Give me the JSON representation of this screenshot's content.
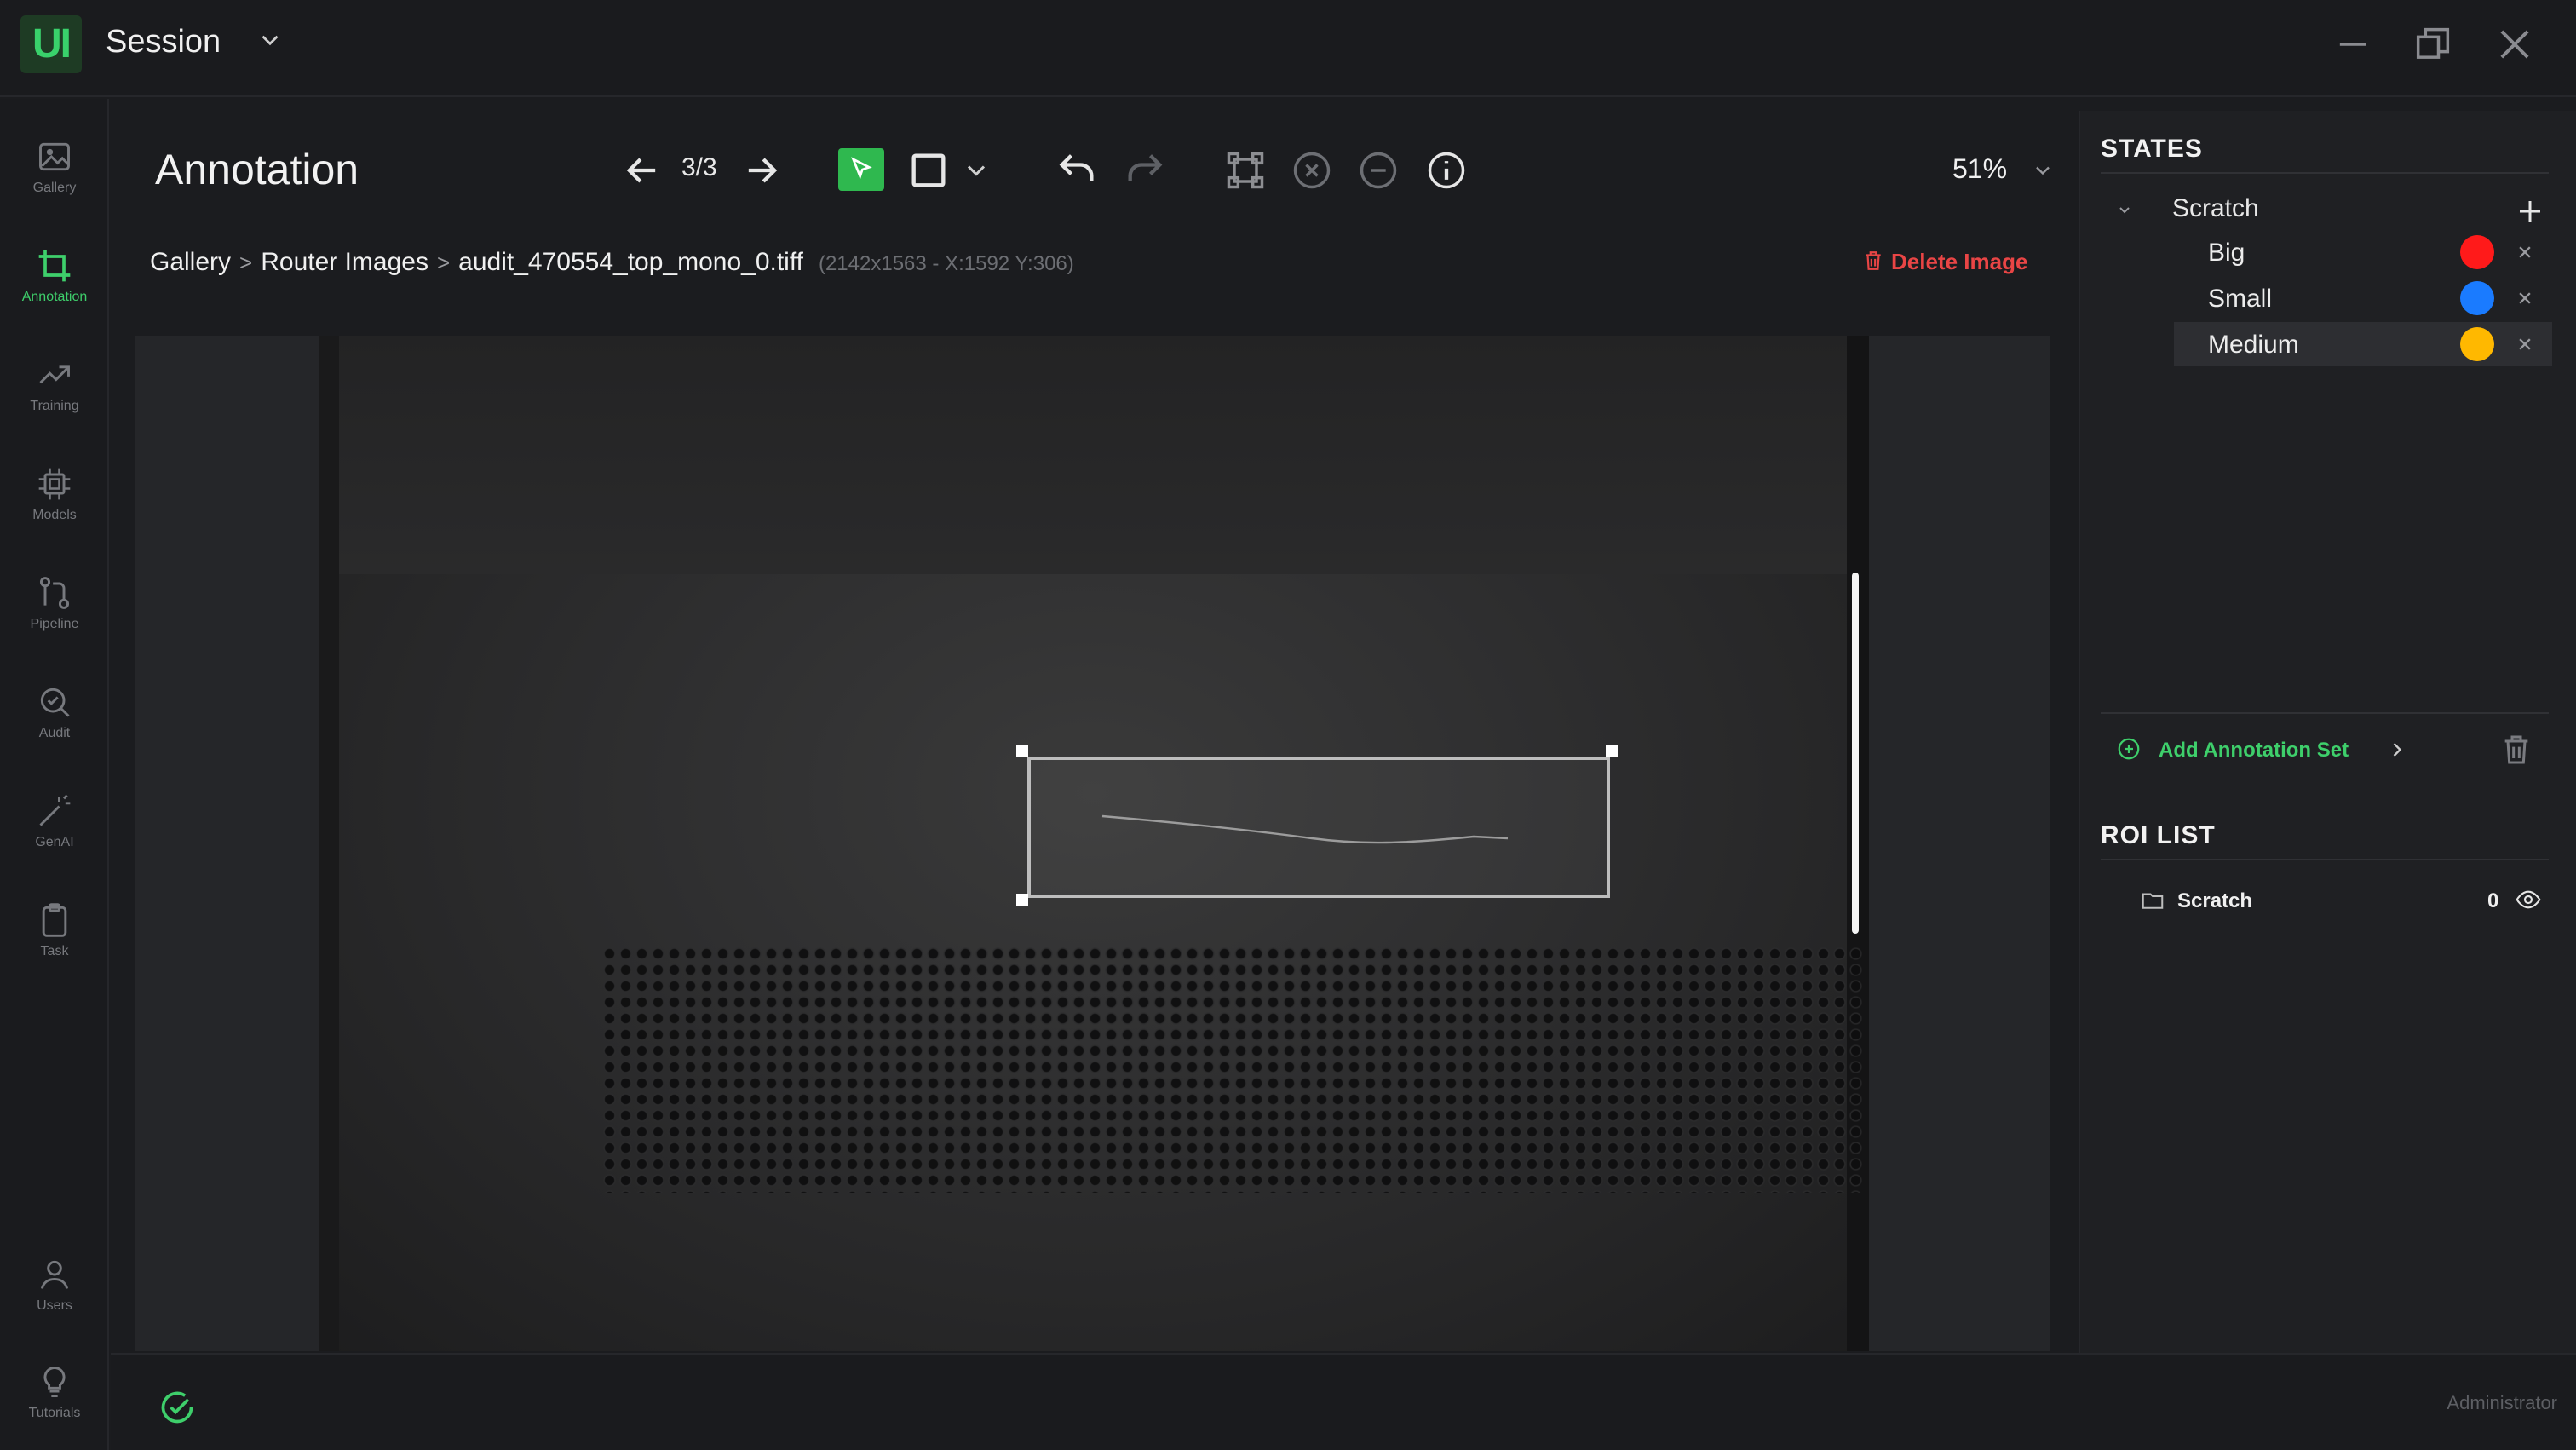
{
  "app": {
    "logo_text": "UI",
    "session_title": "Session",
    "brand_color": "#3ecf6b"
  },
  "sidebar": {
    "items": [
      {
        "label": "Gallery",
        "icon": "image-icon"
      },
      {
        "label": "Annotation",
        "icon": "crop-icon",
        "active": true
      },
      {
        "label": "Training",
        "icon": "trend-icon"
      },
      {
        "label": "Models",
        "icon": "chip-icon"
      },
      {
        "label": "Pipeline",
        "icon": "pipeline-icon"
      },
      {
        "label": "Audit",
        "icon": "audit-icon"
      },
      {
        "label": "GenAI",
        "icon": "wand-icon"
      },
      {
        "label": "Task",
        "icon": "clipboard-icon"
      },
      {
        "label": "Users",
        "icon": "user-icon"
      },
      {
        "label": "Tutorials",
        "icon": "lightbulb-icon"
      }
    ]
  },
  "main": {
    "title": "Annotation",
    "counter": "3/3",
    "zoom": "51%"
  },
  "breadcrumb": {
    "items": [
      "Gallery",
      "Router Images",
      "audit_470554_top_mono_0.tiff"
    ],
    "separator": ">",
    "meta": "(2142x1563 - X:1592 Y:306)"
  },
  "delete_image_label": "Delete Image",
  "states_panel": {
    "title": "STATES",
    "parent": "Scratch",
    "states": [
      {
        "label": "Big",
        "color": "#ff1a1a"
      },
      {
        "label": "Small",
        "color": "#1a7bff"
      },
      {
        "label": "Medium",
        "color": "#ffb800",
        "selected": true
      }
    ],
    "add_set_label": "Add Annotation Set"
  },
  "roi_panel": {
    "title": "ROI LIST",
    "items": [
      {
        "label": "Scratch",
        "count": "0"
      }
    ]
  },
  "footer": {
    "user_label": "Administrator"
  }
}
